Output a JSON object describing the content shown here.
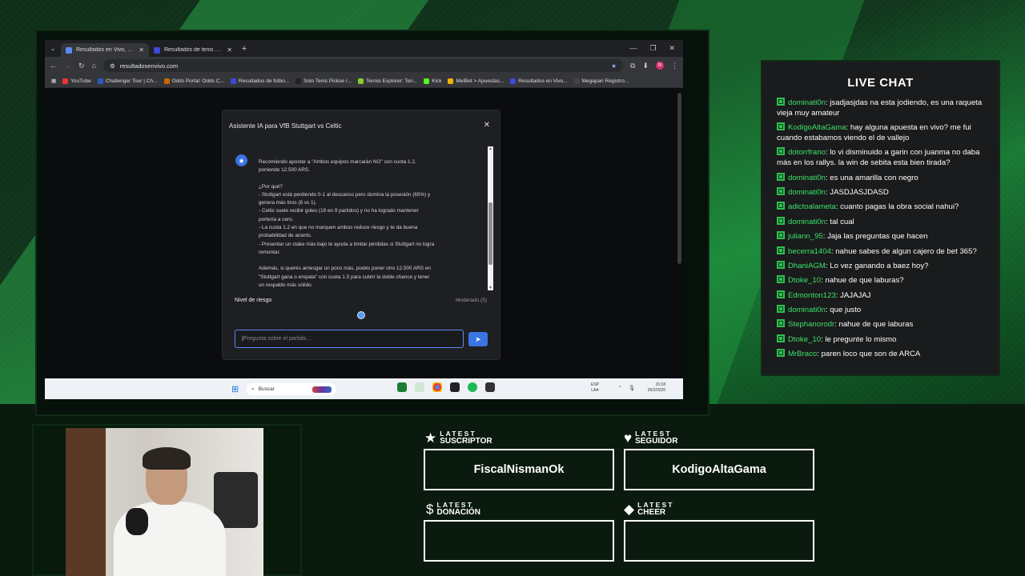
{
  "browser": {
    "tabs": [
      {
        "label": "Resultados en Vivo, Datos de L",
        "active": true
      },
      {
        "label": "Resultados de tenis en directo",
        "active": false
      }
    ],
    "url": "resultadosenvivo.com",
    "bookmarks": [
      "YouTube",
      "Challenger Tour | Ch...",
      "Odds Portal: Odds C...",
      "Resultados de fútbo...",
      "Solo Tenis Pickse /...",
      "Tennis Explorer: Ten...",
      "Kick",
      "MelBet > Apuestas...",
      "Resultados en Vivo...",
      "Megapari Registro..."
    ]
  },
  "dialog": {
    "title": "Asistente IA para VfB Stuttgart vs Celtic",
    "message": {
      "intro": "Recomiendo apostar a \"Ambos equipos marcarán NO\" con cuota 1.2, poniendo 12.500 ARS.",
      "why_title": "¿Por qué?",
      "reasons": [
        "- Stuttgart está perdiendo 0-1 al descanso pero domina la posesión (65%) y genera más tiros (8 vs 1).",
        "- Celtic suele recibir goles (19 en 9 partidos) y no ha logrado mantener portería a cero.",
        "- La cuota 1.2 en que no marquen ambos reduce riesgo y te da buena probabilidad de acierto.",
        "- Presentar un stake más bajo te ayuda a limitar pérdidas si Stuttgart no logra remontar."
      ],
      "extra": "Además, si querés arriesgar un poco más, podés poner otro 12.500 ARS en \"Stuttgart gana o empata\" con cuota 1.5 para cubrir la doble chance y tener un respaldo más sólido."
    },
    "risk_label": "Nivel de riesgo",
    "risk_value": "Moderado (5)",
    "risk_level": 0.5,
    "input_placeholder": "Pregunta sobre el partido..."
  },
  "taskbar": {
    "search": "Buscar",
    "lang": "ESP\nLAA",
    "time": "15:18",
    "date": "26/2/2026"
  },
  "chat": {
    "title": "LIVE CHAT",
    "messages": [
      {
        "user": "dominati0n",
        "text": "jsadjasjdas na esta jodiendo, es una raqueta vieja muy amateur"
      },
      {
        "user": "KodigoAltaGama",
        "text": "hay alguna apuesta en vivo? me fui cuando estabamos viendo el de vallejo"
      },
      {
        "user": "dotorrfrano",
        "text": "lo vi disminuido a garin con juanma no daba más en los rallys. la win de sebita esta bien tirada?"
      },
      {
        "user": "dominati0n",
        "text": "es una amarilla con negro"
      },
      {
        "user": "dominati0n",
        "text": "JASDJASJDASD"
      },
      {
        "user": "adictoalameta",
        "text": "cuanto pagas la obra social nahui?"
      },
      {
        "user": "dominati0n",
        "text": "tal cual"
      },
      {
        "user": "juliann_95",
        "text": "Jaja las preguntas que hacen"
      },
      {
        "user": "becerra1404",
        "text": "nahue sabes de algun cajero de bet 365?"
      },
      {
        "user": "DhaniAGM",
        "text": "Lo vez ganando a baez hoy?"
      },
      {
        "user": "Dtoke_10",
        "text": "nahue de que laburas?"
      },
      {
        "user": "Edmonton123",
        "text": "JAJAJAJ"
      },
      {
        "user": "dominati0n",
        "text": "que justo"
      },
      {
        "user": "Stephanorodr",
        "text": "nahue de que laburas"
      },
      {
        "user": "Dtoke_10",
        "text": "le pregunte lo mismo"
      },
      {
        "user": "MrBraco",
        "text": "paren loco que son de ARCA"
      }
    ]
  },
  "latest": {
    "suscriptor": {
      "small": "LATEST",
      "big": "SUSCRIPTOR",
      "value": "FiscalNismanOk"
    },
    "seguidor": {
      "small": "LATEST",
      "big": "SEGUIDOR",
      "value": "KodigoAltaGama"
    },
    "donacion": {
      "small": "LATEST",
      "big": "DONACIÓN",
      "value": ""
    },
    "cheer": {
      "small": "LATEST",
      "big": "CHEER",
      "value": ""
    }
  }
}
